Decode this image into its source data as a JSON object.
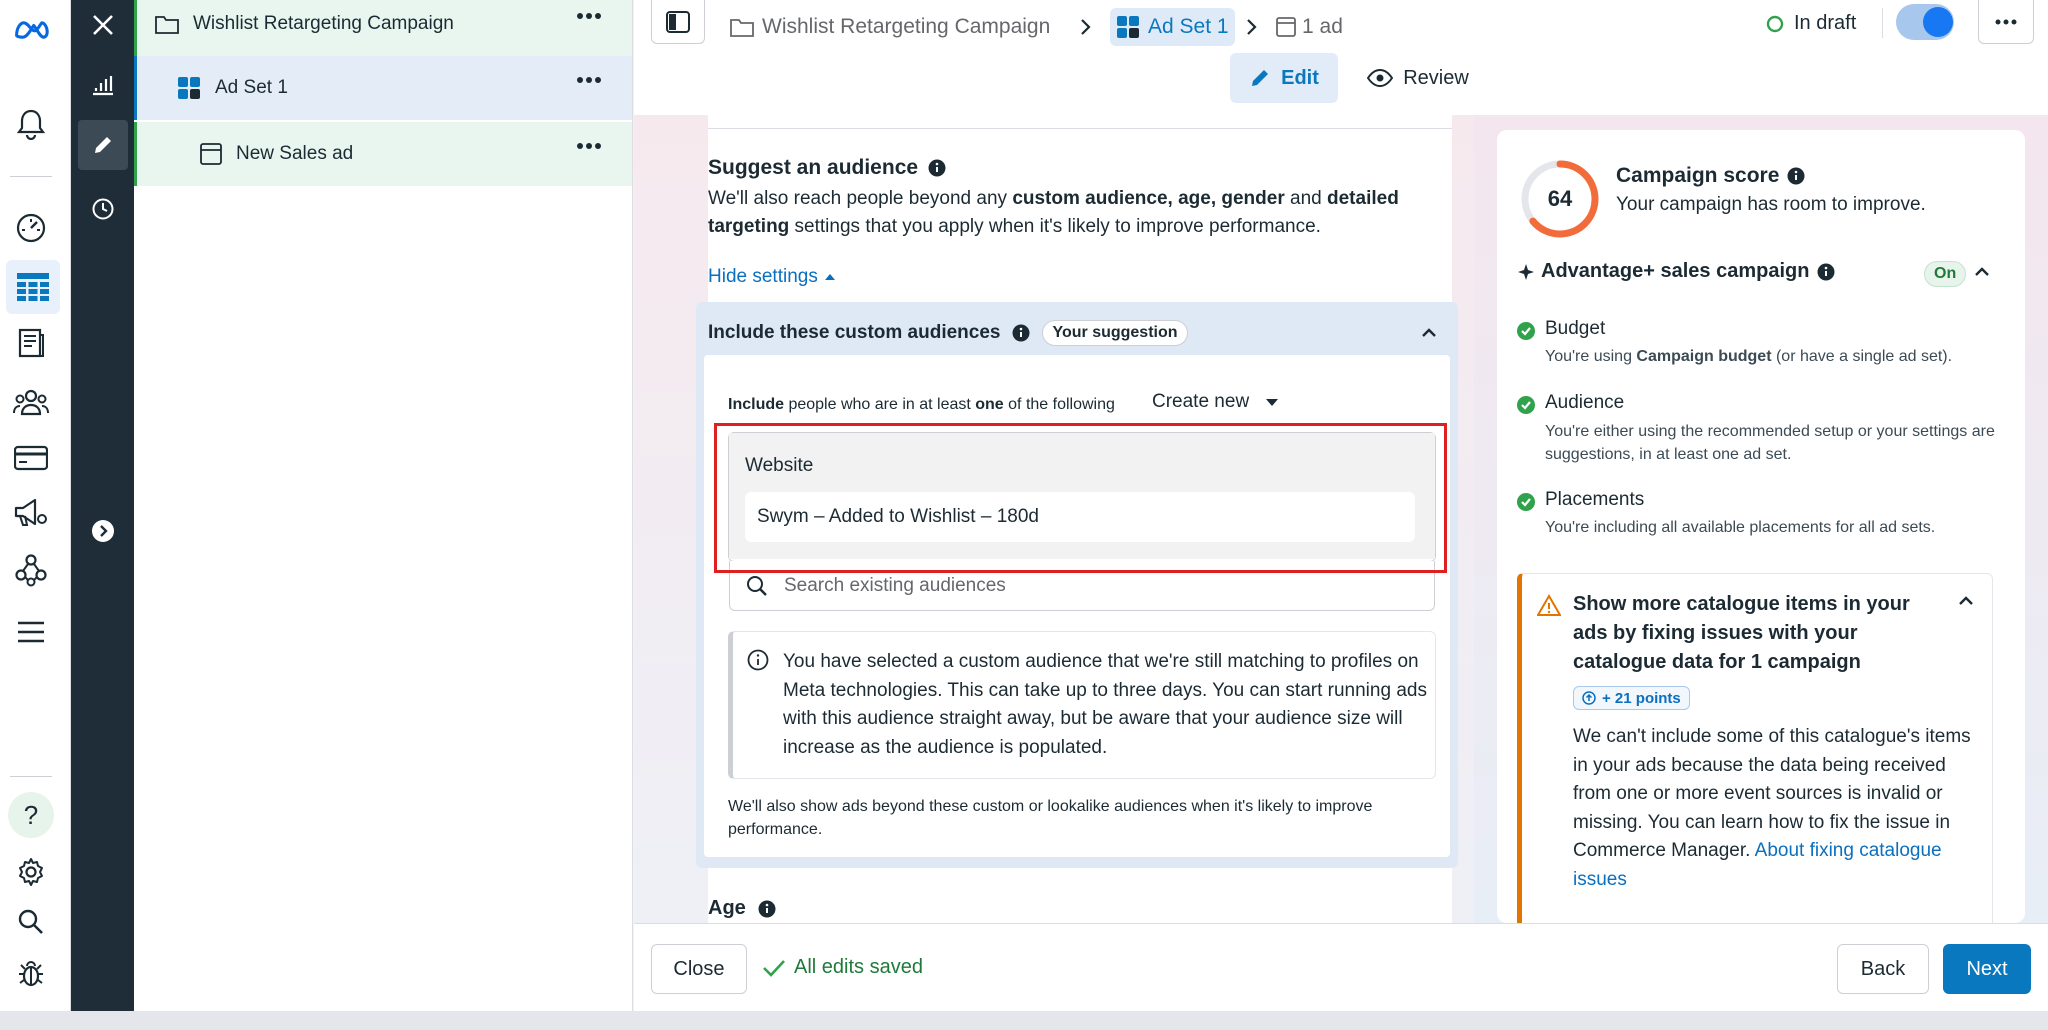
{
  "global_nav": {
    "icons": [
      "meta-logo-icon",
      "bell-icon",
      "dashboard-icon",
      "table-icon",
      "pages-icon",
      "audience-icon",
      "billing-icon",
      "megaphone-icon",
      "network-icon",
      "menu-icon",
      "help-icon",
      "settings-icon",
      "search-icon",
      "bug-icon"
    ],
    "help_label": "?"
  },
  "tree": {
    "campaign": "Wishlist Retargeting Campaign",
    "adset": "Ad Set 1",
    "ad": "New Sales ad"
  },
  "header": {
    "breadcrumb_campaign": "Wishlist Retargeting Campaign",
    "breadcrumb_adset": "Ad Set 1",
    "breadcrumb_ad": "1 ad",
    "status": "In draft",
    "edit_tab": "Edit",
    "review_tab": "Review"
  },
  "audience": {
    "title": "Suggest an audience",
    "desc_1": "We'll also reach people beyond any ",
    "desc_b1": "custom audience, age, gender",
    "desc_2": " and ",
    "desc_b2": "detailed",
    "desc_b3": "targeting",
    "desc_3": " settings that you apply when it's likely to improve performance.",
    "hide_settings": "Hide settings",
    "custom_title": "Include these custom audiences",
    "suggestion_badge": "Your suggestion",
    "include_b1": "Include",
    "include_1": " people who are in at least ",
    "include_b2": "one",
    "include_2": " of the following",
    "create_new": "Create new",
    "source_label": "Website",
    "selected_audience": "Swym – Added to Wishlist – 180d",
    "search_placeholder": "Search existing audiences",
    "info_note": "You have selected a custom audience that we're still matching to profiles on Meta technologies. This can take up to three days. You can start running ads with this audience straight away, but be aware that your audience size will increase as the audience is populated.",
    "beyond_note": "We'll also show ads beyond these custom or lookalike audiences when it's likely to improve performance.",
    "age_title": "Age"
  },
  "score": {
    "value": "64",
    "fraction": 0.64,
    "title": "Campaign score",
    "subtitle": "Your campaign has room to improve.",
    "advantage_title": "Advantage+ sales campaign",
    "advantage_state": "On",
    "checks": [
      {
        "title": "Budget",
        "desc_1": "You're using ",
        "desc_b": "Campaign budget",
        "desc_2": " (or have a single ad set)."
      },
      {
        "title": "Audience",
        "desc": "You're either using the recommended setup or your settings are suggestions, in at least one ad set."
      },
      {
        "title": "Placements",
        "desc": "You're including all available placements for all ad sets."
      }
    ],
    "alert_title": "Show more catalogue items in your ads by fixing issues with your catalogue data for 1 campaign",
    "alert_points": "+ 21 points",
    "alert_body": "We can't include some of this catalogue's items in your ads because the data being received from one or more event sources is invalid or missing. You can learn how to fix the issue in Commerce Manager. ",
    "alert_link": "About fixing catalogue issues"
  },
  "footer": {
    "close": "Close",
    "saved": "All edits saved",
    "back": "Back",
    "next": "Next"
  },
  "colors": {
    "accent": "#0a78be",
    "success": "#31a24c",
    "warning": "#e37400",
    "highlight": "#e02020",
    "score_ring": "#f26b3a"
  }
}
